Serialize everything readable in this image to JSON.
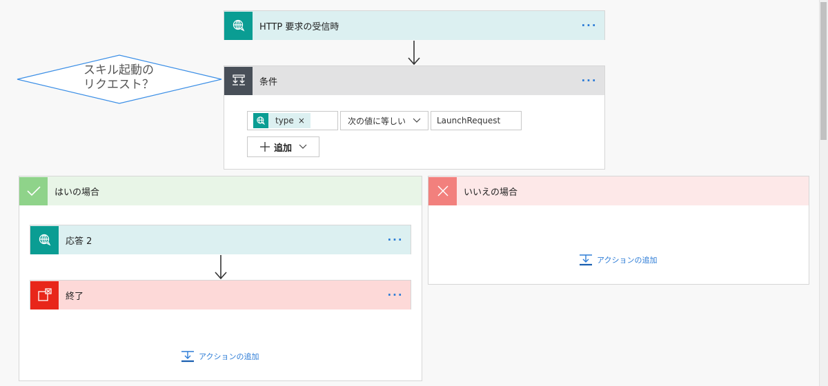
{
  "trigger": {
    "title": "HTTP 要求の受信時",
    "more": "···"
  },
  "condition": {
    "title": "条件",
    "more": "···",
    "token": "type",
    "token_remove": "×",
    "operator": "次の値に等しい",
    "value": "LaunchRequest",
    "add_label": "追加"
  },
  "callout": {
    "line1": "スキル起動の",
    "line2": "リクエスト？"
  },
  "yes_branch": {
    "title": "はいの場合",
    "actions": [
      {
        "title": "応答 2",
        "more": "···"
      },
      {
        "title": "終了",
        "more": "···"
      }
    ],
    "add_action": "アクションの追加"
  },
  "no_branch": {
    "title": "いいえの場合",
    "add_action": "アクションの追加"
  },
  "colors": {
    "http_teal": "#0a9d93",
    "http_header_bg": "#dcf0f1",
    "condition_dark": "#484f58",
    "condition_header_bg": "#e2e2e3",
    "yes_green": "#8fd38a",
    "yes_header_bg": "#e8f5e7",
    "no_red": "#f2807d",
    "no_header_bg": "#fde8e8",
    "terminate_red": "#e8261a",
    "terminate_header_bg": "#fdd9d8",
    "link_blue": "#2b7bd6"
  }
}
